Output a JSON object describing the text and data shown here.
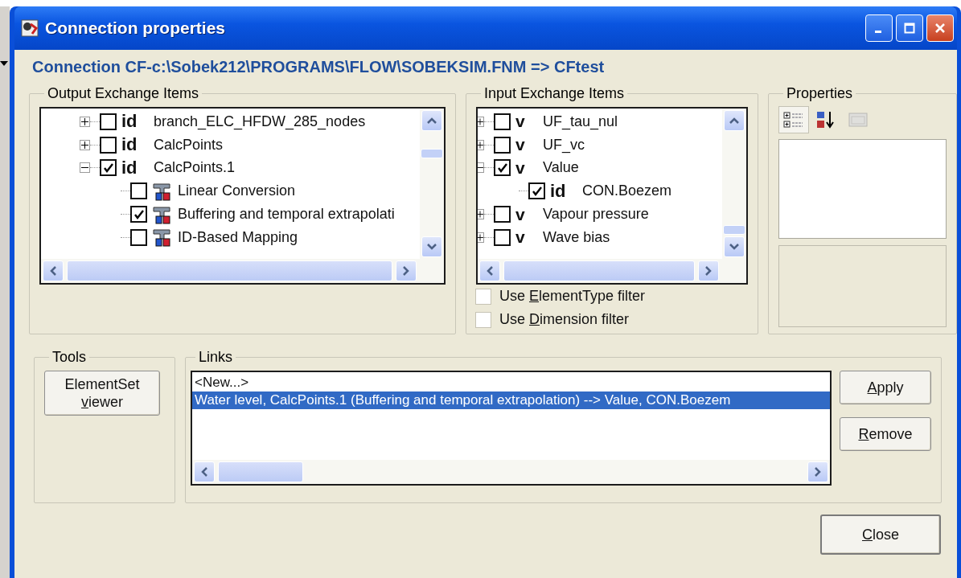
{
  "window": {
    "title": "Connection properties"
  },
  "heading": "Connection CF-c:\\Sobek212\\PROGRAMS\\FLOW\\SOBEKSIM.FNM => CFtest",
  "output_items": {
    "title": "Output Exchange Items",
    "tree": [
      {
        "kind": "element_set",
        "badge": "id",
        "label": "branch_ELC_HFDW_285_nodes",
        "checked": false,
        "expanded": false
      },
      {
        "kind": "element_set",
        "badge": "id",
        "label": "CalcPoints",
        "checked": false,
        "expanded": false
      },
      {
        "kind": "element_set",
        "badge": "id",
        "label": "CalcPoints.1",
        "checked": true,
        "expanded": true,
        "children": [
          {
            "kind": "converter",
            "label": "Linear Conversion",
            "checked": false
          },
          {
            "kind": "converter",
            "label": "Buffering and temporal extrapolati",
            "checked": true
          },
          {
            "kind": "converter",
            "label": "ID-Based Mapping",
            "checked": false
          }
        ]
      }
    ]
  },
  "input_items": {
    "title": "Input Exchange Items",
    "tree": [
      {
        "kind": "quantity",
        "badge": "v",
        "label": "UF_tau_nul",
        "checked": false,
        "expanded": false
      },
      {
        "kind": "quantity",
        "badge": "v",
        "label": "UF_vc",
        "checked": false,
        "expanded": false
      },
      {
        "kind": "quantity",
        "badge": "v",
        "label": "Value",
        "checked": true,
        "expanded": true,
        "children": [
          {
            "kind": "element_set",
            "badge": "id",
            "label": "CON.Boezem",
            "checked": true
          }
        ]
      },
      {
        "kind": "quantity",
        "badge": "v",
        "label": "Vapour pressure",
        "checked": false,
        "expanded": false
      },
      {
        "kind": "quantity",
        "badge": "v",
        "label": "Wave bias",
        "checked": false,
        "expanded": false
      }
    ],
    "filters": [
      {
        "pre": "Use ",
        "key": "E",
        "post": "lementType filter",
        "checked": false
      },
      {
        "pre": "Use ",
        "key": "D",
        "post": "imension filter",
        "checked": false
      }
    ]
  },
  "properties": {
    "title": "Properties",
    "toolbar": [
      {
        "kind": "categorized",
        "selected": true,
        "disabled": false
      },
      {
        "kind": "alphabetical",
        "selected": false,
        "disabled": false
      },
      {
        "kind": "pages",
        "selected": false,
        "disabled": true
      }
    ]
  },
  "tools": {
    "title": "Tools",
    "button": {
      "line1": "ElementSet",
      "key": "v",
      "post": "iewer"
    }
  },
  "links": {
    "title": "Links",
    "items": [
      {
        "label": "<New...>",
        "selected": false
      },
      {
        "label": "Water level, CalcPoints.1 (Buffering and temporal extrapolation) --> Value, CON.Boezem",
        "selected": true
      }
    ],
    "buttons": [
      {
        "key": "A",
        "post": "pply"
      },
      {
        "key": "R",
        "post": "emove"
      }
    ]
  },
  "close_button": {
    "key": "C",
    "post": "lose"
  }
}
